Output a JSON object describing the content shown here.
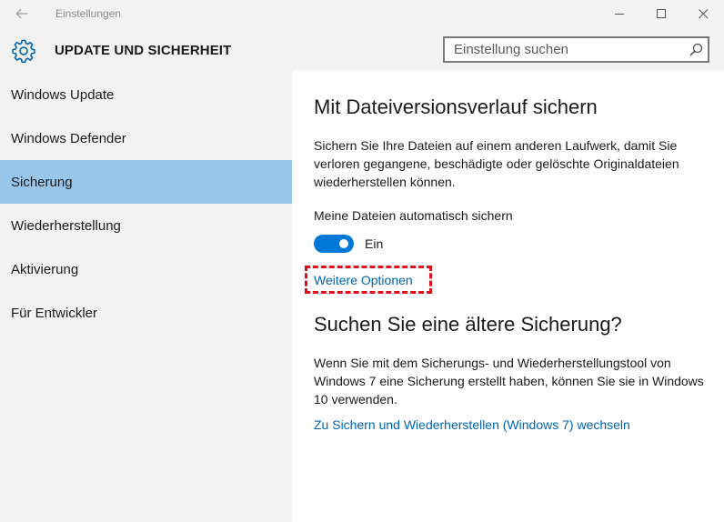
{
  "window": {
    "app_title": "Einstellungen"
  },
  "header": {
    "title": "UPDATE UND SICHERHEIT",
    "search_placeholder": "Einstellung suchen"
  },
  "sidebar": {
    "items": [
      {
        "label": "Windows Update",
        "active": false
      },
      {
        "label": "Windows Defender",
        "active": false
      },
      {
        "label": "Sicherung",
        "active": true
      },
      {
        "label": "Wiederherstellung",
        "active": false
      },
      {
        "label": "Aktivierung",
        "active": false
      },
      {
        "label": "Für Entwickler",
        "active": false
      }
    ]
  },
  "main": {
    "heading": "Mit Dateiversionsverlauf sichern",
    "description": "Sichern Sie Ihre Dateien auf einem anderen Laufwerk, damit Sie verloren gegangene, beschädigte oder gelöschte Originaldateien wiederherstellen können.",
    "toggle_label": "Meine Dateien automatisch sichern",
    "toggle_state": "Ein",
    "toggle_on": true,
    "more_options_link": "Weitere Optionen",
    "older_backup_heading": "Suchen Sie eine ältere Sicherung?",
    "older_backup_text": "Wenn Sie mit dem Sicherungs- und Wiederherstellungstool von Windows 7 eine Sicherung erstellt haben, können Sie sie in Windows 10 verwenden.",
    "win7_link": "Zu Sichern und Wiederherstellen (Windows 7) wechseln"
  },
  "colors": {
    "accent": "#0078d7",
    "link": "#0063b1",
    "selected_nav": "#98c5ea",
    "highlight_border": "#e0101a"
  },
  "icons": {
    "back": "back-arrow-icon",
    "settings": "gear-icon",
    "search": "search-icon",
    "minimize": "minimize-icon",
    "maximize": "maximize-icon",
    "close": "close-icon"
  }
}
